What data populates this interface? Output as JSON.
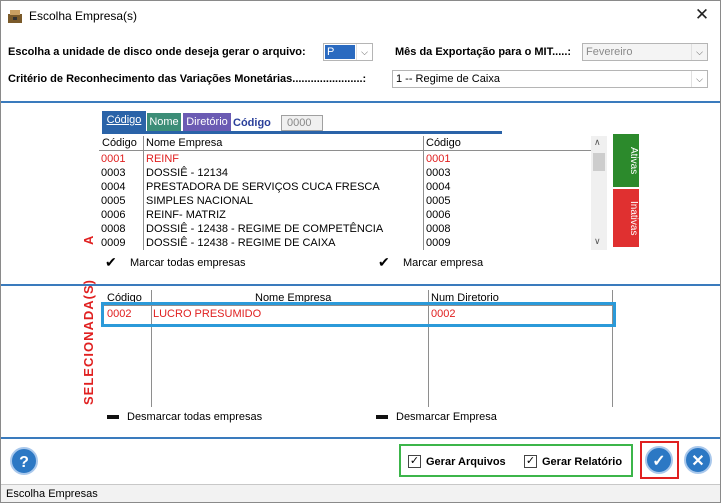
{
  "window": {
    "title": "Escolha Empresa(s)"
  },
  "options": {
    "disk_label": "Escolha a unidade de disco onde deseja gerar o arquivo:",
    "disk_value": "P",
    "month_label": "Mês da Exportação para o MIT.....:",
    "month_value": "Fevereiro",
    "criteria_label": "Critério de Reconhecimento das Variações Monetárias.......................:",
    "criteria_value": "1 -- Regime de Caixa"
  },
  "filter": {
    "tabs": [
      "Código",
      "Nome",
      "Diretório"
    ],
    "field_label": "Código",
    "field_value": "0000"
  },
  "to_select": {
    "side_label": "A SELECIONAR",
    "columns": [
      "Código",
      "Nome Empresa",
      "Código"
    ],
    "rows": [
      [
        "0001",
        "REINF",
        "0001"
      ],
      [
        "0003",
        "DOSSIÊ - 12134",
        "0003"
      ],
      [
        "0004",
        "PRESTADORA DE SERVIÇOS CUCA FRESCA",
        "0004"
      ],
      [
        "0005",
        "SIMPLES NACIONAL",
        "0005"
      ],
      [
        "0006",
        "REINF-  MATRIZ",
        "0006"
      ],
      [
        "0008",
        "DOSSIÊ - 12438 - REGIME DE COMPETÊNCIA",
        "0008"
      ],
      [
        "0009",
        "DOSSIÊ - 12438 - REGIME DE CAIXA",
        "0009"
      ]
    ],
    "active_btn": "Ativas",
    "inactive_btn": "Inativas",
    "mark_all": "Marcar todas empresas",
    "mark_one": "Marcar empresa"
  },
  "selected": {
    "side_label": "SELECIONADA(S)",
    "columns": [
      "Código",
      "Nome Empresa",
      "Num Diretorio"
    ],
    "rows": [
      [
        "0002",
        "LUCRO PRESUMIDO",
        "0002"
      ]
    ],
    "unmark_all": "Desmarcar todas empresas",
    "unmark_one": "Desmarcar Empresa"
  },
  "footer": {
    "gen_files": "Gerar Arquivos",
    "gen_report": "Gerar Relatório",
    "help": "?",
    "status": "Escolha Empresas"
  },
  "colors": {
    "accent": "#3a7bbd",
    "red_text": "#e02020",
    "green_btn": "#2c8a2c",
    "red_btn": "#e03030",
    "tab_blue": "#2a63a8",
    "tab_green": "#3c8d77",
    "tab_purple": "#6b5bb3"
  }
}
